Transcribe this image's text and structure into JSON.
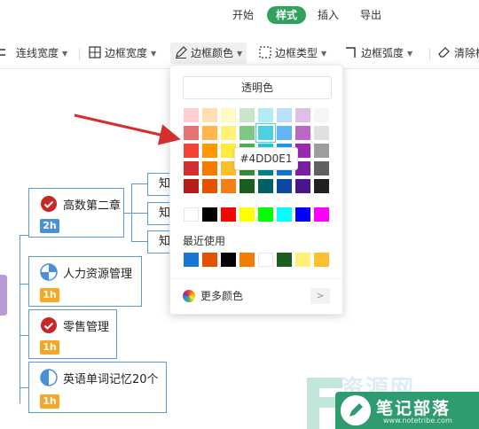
{
  "tabs": {
    "items": [
      {
        "label": "开始",
        "active": false
      },
      {
        "label": "样式",
        "active": true
      },
      {
        "label": "插入",
        "active": false
      },
      {
        "label": "导出",
        "active": false
      }
    ]
  },
  "toolbar": {
    "line_width": "连线宽度",
    "border_width": "边框宽度",
    "border_color": "边框颜色",
    "border_type": "边框类型",
    "border_radius": "边框弧度",
    "clear": "清除样"
  },
  "color_panel": {
    "transparent_label": "透明色",
    "hover_tooltip": "#4DD0E1",
    "theme_colors": [
      [
        "#ffcdd2",
        "#ffe0b2",
        "#fff9c4",
        "#c8e6c9",
        "#b2ebf2",
        "#bbdefb",
        "#e1bee7",
        "#f5f5f5"
      ],
      [
        "#e57373",
        "#ffb74d",
        "#fff176",
        "#81c784",
        "#4dd0e1",
        "#64b5f6",
        "#ba68c8",
        "#e0e0e0"
      ],
      [
        "#f44336",
        "#ff9800",
        "#ffeb3b",
        "#4caf50",
        "#26c6da",
        "#2196f3",
        "#9c27b0",
        "#9e9e9e"
      ],
      [
        "#d32f2f",
        "#f57c00",
        "#fbc02d",
        "#388e3c",
        "#00838f",
        "#1976d2",
        "#7b1fa2",
        "#616161"
      ],
      [
        "#b71c1c",
        "#e65100",
        "#f57f17",
        "#1b5e20",
        "#006064",
        "#0d47a1",
        "#4a148c",
        "#212121"
      ]
    ],
    "basic_colors": [
      "#ffffff",
      "#000000",
      "#ff0000",
      "#ffff00",
      "#00ff00",
      "#00ffff",
      "#0000ff",
      "#ff00ff"
    ],
    "recent_label": "最近使用",
    "recent_colors": [
      "#1976d2",
      "#e65100",
      "#000000",
      "#f57c00",
      "#ffffff",
      "#1b5e20",
      "#fff176",
      "#fbc02d"
    ],
    "more_colors_label": "更多颜色",
    "more_arrow": ">"
  },
  "mindmap": {
    "nodes": [
      {
        "title": "高数第二章",
        "tag": "2h",
        "icon": "check-circle-icon"
      },
      {
        "title": "人力资源管理",
        "tag": "1h",
        "icon": "half-pie-icon"
      },
      {
        "title": "零售管理",
        "tag": "1h",
        "icon": "check-circle-icon"
      },
      {
        "title": "英语单词记忆20个",
        "tag": "1h",
        "icon": "half-circle-icon"
      }
    ],
    "subnodes": [
      "知",
      "知",
      "知"
    ]
  },
  "watermark": {
    "bg_text": "资源网",
    "brand": "笔记部落",
    "url": "www.notetribe.com"
  },
  "colors": {
    "accent_green": "#2fa35b",
    "node_border": "#5b9bd5",
    "arrow_red": "#d32f2f"
  }
}
